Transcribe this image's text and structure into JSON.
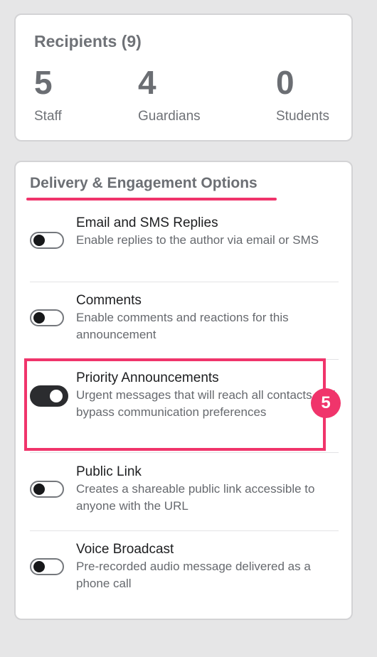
{
  "recipients": {
    "title": "Recipients (9)",
    "stats": [
      {
        "count": "5",
        "label": "Staff"
      },
      {
        "count": "4",
        "label": "Guardians"
      },
      {
        "count": "0",
        "label": "Students"
      }
    ]
  },
  "options": {
    "title": "Delivery & Engagement Options",
    "items": [
      {
        "name": "Email and SMS Replies",
        "description": "Enable replies to the author via email or SMS",
        "enabled": false
      },
      {
        "name": "Comments",
        "description": "Enable comments and reactions for this announcement",
        "enabled": false
      },
      {
        "name": "Priority Announcements",
        "description": "Urgent messages that will reach all contacts and bypass communication preferences",
        "enabled": true
      },
      {
        "name": "Public Link",
        "description": "Creates a shareable public link accessible to anyone with the URL",
        "enabled": false
      },
      {
        "name": "Voice Broadcast",
        "description": "Pre-recorded audio message delivered as a phone call",
        "enabled": false
      }
    ]
  },
  "annotation": {
    "step": "5",
    "color": "#f0346b"
  }
}
